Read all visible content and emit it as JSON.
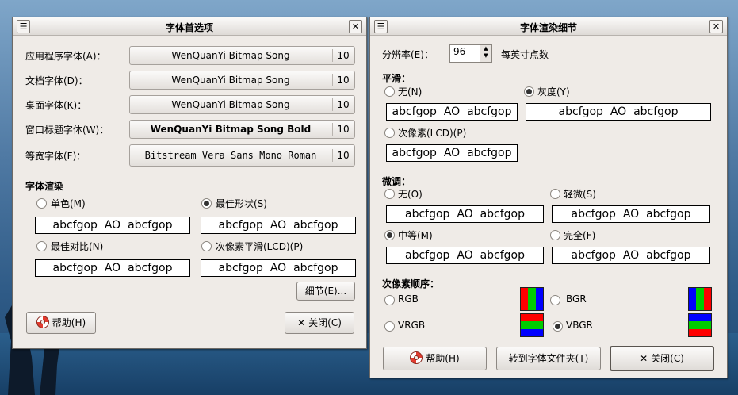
{
  "font_prefs": {
    "title": "字体首选项",
    "rows": [
      {
        "label": "应用程序字体(A)：",
        "font": "WenQuanYi Bitmap Song",
        "size": "10"
      },
      {
        "label": "文档字体(D)：",
        "font": "WenQuanYi Bitmap Song",
        "size": "10"
      },
      {
        "label": "桌面字体(K)：",
        "font": "WenQuanYi Bitmap Song",
        "size": "10"
      },
      {
        "label": "窗口标题字体(W)：",
        "font": "WenQuanYi Bitmap Song Bold",
        "size": "10"
      },
      {
        "label": "等宽字体(F)：",
        "font": "Bitstream Vera Sans Mono Roman",
        "size": "10"
      }
    ],
    "render_heading": "字体渲染",
    "render_options": [
      {
        "label": "单色(M)",
        "selected": false,
        "preview": "abcfgop  AO  abcfgop"
      },
      {
        "label": "最佳形状(S)",
        "selected": true,
        "preview": "abcfgop  AO  abcfgop"
      },
      {
        "label": "最佳对比(N)",
        "selected": false,
        "preview": "abcfgop  AO  abcfgop"
      },
      {
        "label": "次像素平滑(LCD)(P)",
        "selected": false,
        "preview": "abcfgop  AO  abcfgop"
      }
    ],
    "details_button": "细节(E)...",
    "help_button": "帮助(H)",
    "close_button": "关闭(C)"
  },
  "render_details": {
    "title": "字体渲染细节",
    "resolution_label": "分辨率(E)：",
    "resolution_value": "96",
    "resolution_unit": "每英寸点数",
    "smoothing_heading": "平滑：",
    "smoothing_options": [
      {
        "label": "无(N)",
        "selected": false,
        "preview": "abcfgop  AO  abcfgop"
      },
      {
        "label": "灰度(Y)",
        "selected": true,
        "preview": "abcfgop  AO  abcfgop"
      },
      {
        "label": "次像素(LCD)(P)",
        "selected": false,
        "preview": "abcfgop  AO  abcfgop"
      }
    ],
    "hinting_heading": "微调：",
    "hinting_options": [
      {
        "label": "无(O)",
        "selected": false,
        "preview": "abcfgop  AO  abcfgop"
      },
      {
        "label": "轻微(S)",
        "selected": false,
        "preview": "abcfgop  AO  abcfgop"
      },
      {
        "label": "中等(M)",
        "selected": true,
        "preview": "abcfgop  AO  abcfgop"
      },
      {
        "label": "完全(F)",
        "selected": false,
        "preview": "abcfgop  AO  abcfgop"
      }
    ],
    "subpixel_heading": "次像素顺序：",
    "subpixel_options": [
      {
        "label": "RGB",
        "selected": false,
        "colors": [
          "#ff0000",
          "#00cc00",
          "#0000ff"
        ]
      },
      {
        "label": "BGR",
        "selected": false,
        "colors": [
          "#0000ff",
          "#00cc00",
          "#ff0000"
        ]
      },
      {
        "label": "VRGB",
        "selected": false,
        "colors": [
          "#ff0000",
          "#00cc00",
          "#0000ff"
        ]
      },
      {
        "label": "VBGR",
        "selected": true,
        "colors": [
          "#0000ff",
          "#00cc00",
          "#ff0000"
        ]
      }
    ],
    "help_button": "帮助(H)",
    "goto_fonts_button": "转到字体文件夹(T)",
    "close_button": "关闭(C)"
  }
}
